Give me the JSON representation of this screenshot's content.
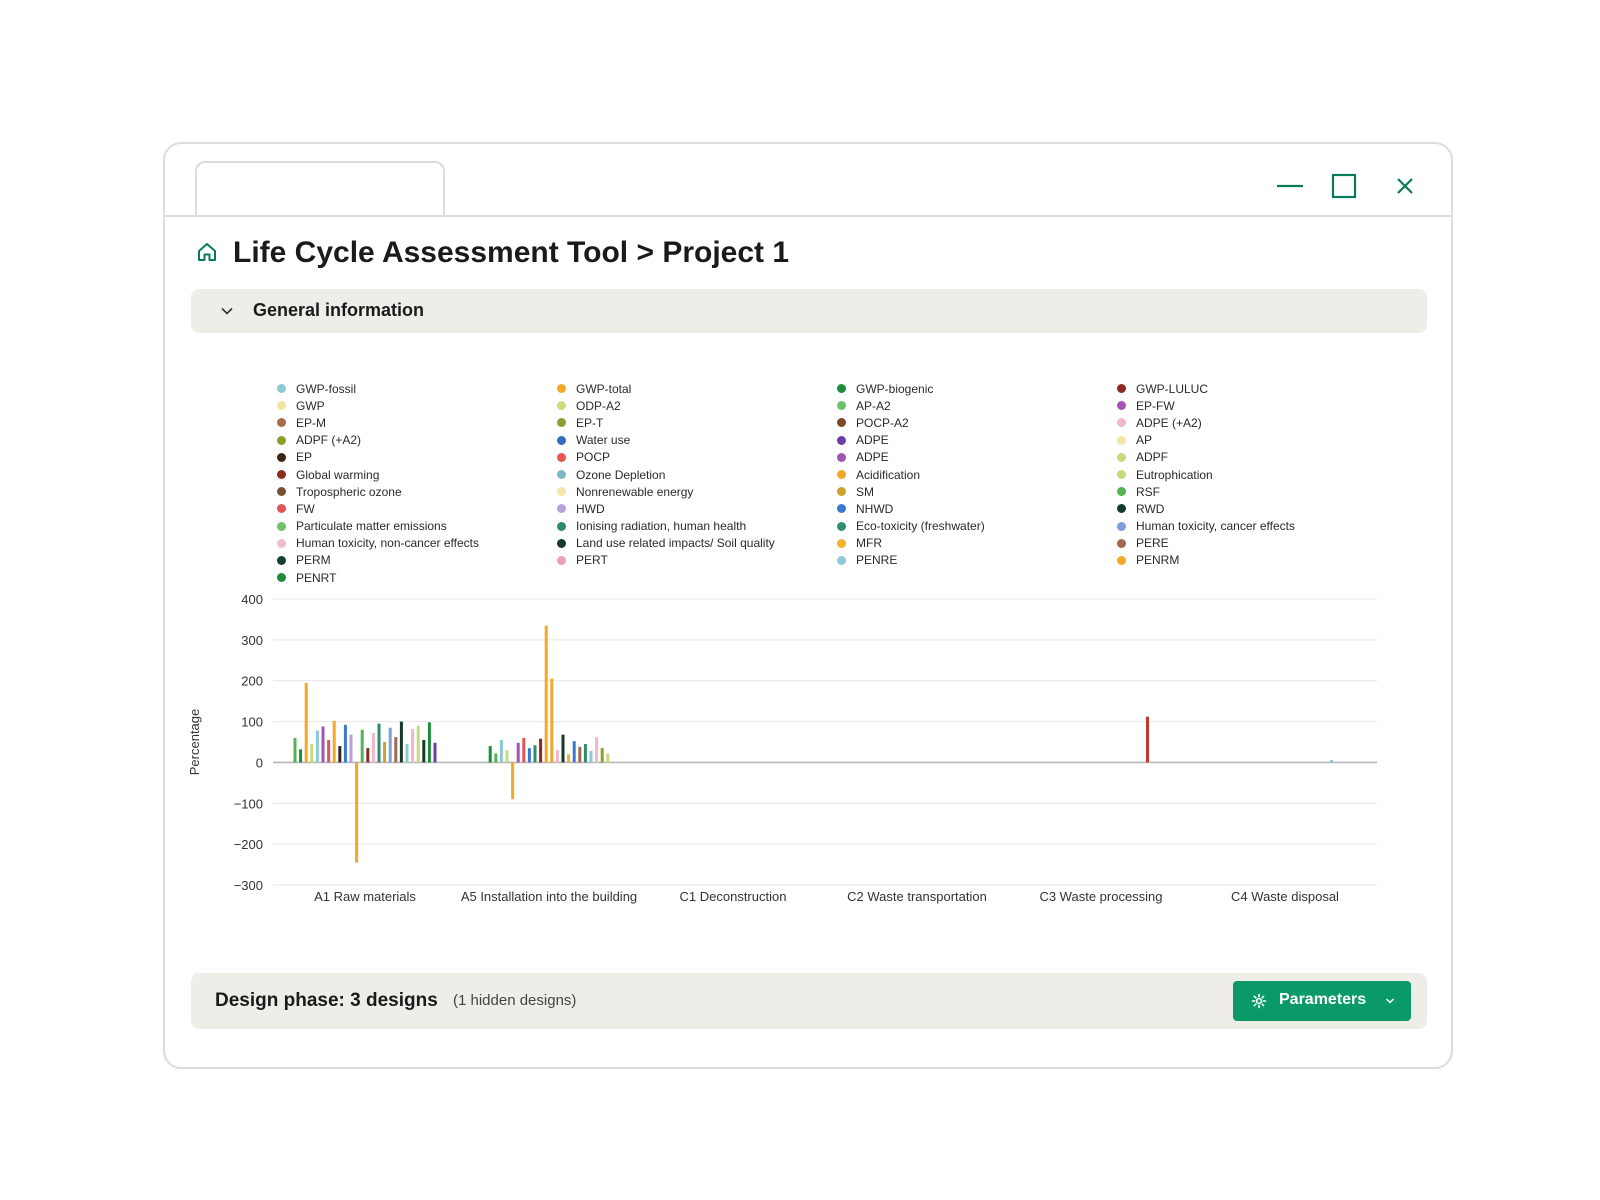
{
  "window": {
    "title": "Life Cycle Assessment Tool > Project 1",
    "tab_label": ""
  },
  "icons": {
    "home": "home-icon",
    "minimize": "minimize-icon",
    "maximize": "maximize-icon",
    "close": "close-icon",
    "chevron": "chevron-down-icon",
    "gear": "gear-icon"
  },
  "accordion": {
    "label": "General information",
    "expanded": false
  },
  "footer": {
    "phase_label": "Design phase: 3 designs",
    "hidden_label": "(1 hidden designs)",
    "parameters_label": "Parameters"
  },
  "colors": {
    "accent": "#0a9a6a",
    "panel_bg": "#efede7"
  },
  "legend": [
    [
      {
        "label": "GWP-fossil",
        "color": "#8ecad6"
      },
      {
        "label": "GWP",
        "color": "#f1e3a1"
      },
      {
        "label": "EP-M",
        "color": "#a9694c"
      },
      {
        "label": "ADPF (+A2)",
        "color": "#8f9d2f"
      },
      {
        "label": "EP",
        "color": "#3a2616"
      },
      {
        "label": "Global warming",
        "color": "#8a2f1e"
      },
      {
        "label": "Tropospheric ozone",
        "color": "#7a4e35"
      },
      {
        "label": "FW",
        "color": "#e25555"
      },
      {
        "label": "Particulate matter emissions",
        "color": "#6ec26a"
      },
      {
        "label": "Human toxicity, non-cancer effects",
        "color": "#f2bccb"
      },
      {
        "label": "PERM",
        "color": "#163f2a"
      },
      {
        "label": "PENRT",
        "color": "#1f8c3b"
      }
    ],
    [
      {
        "label": "GWP-total",
        "color": "#f3a827"
      },
      {
        "label": "ODP-A2",
        "color": "#c9dd7c"
      },
      {
        "label": "EP-T",
        "color": "#8b9e37"
      },
      {
        "label": "Water use",
        "color": "#2f6cc2"
      },
      {
        "label": "POCP",
        "color": "#e6554e"
      },
      {
        "label": "Ozone Depletion",
        "color": "#79b8c7"
      },
      {
        "label": "Nonrenewable energy",
        "color": "#f2e6ae"
      },
      {
        "label": "HWD",
        "color": "#b6a1dd"
      },
      {
        "label": "Ionising radiation, human health",
        "color": "#2e8b6b"
      },
      {
        "label": "Land use related impacts/ Soil quality",
        "color": "#143a2a"
      },
      {
        "label": "PERT",
        "color": "#ee9fb6"
      }
    ],
    [
      {
        "label": "GWP-biogenic",
        "color": "#1d8a3c"
      },
      {
        "label": "AP-A2",
        "color": "#6bc268"
      },
      {
        "label": "POCP-A2",
        "color": "#7a4a2b"
      },
      {
        "label": "ADPE",
        "color": "#6a3fa6"
      },
      {
        "label": "ADPE",
        "color": "#a454b5"
      },
      {
        "label": "Acidification",
        "color": "#f2a72a"
      },
      {
        "label": "SM",
        "color": "#c9a32c"
      },
      {
        "label": "NHWD",
        "color": "#3b79d0"
      },
      {
        "label": "Eco-toxicity (freshwater)",
        "color": "#2e8d6b"
      },
      {
        "label": "MFR",
        "color": "#f3b32b"
      },
      {
        "label": "PENRE",
        "color": "#8fcad6"
      }
    ],
    [
      {
        "label": "GWP-LULUC",
        "color": "#8b2a1e"
      },
      {
        "label": "EP-FW",
        "color": "#a454b5"
      },
      {
        "label": "ADPE (+A2)",
        "color": "#f2b7c8"
      },
      {
        "label": "AP",
        "color": "#f3e6a4"
      },
      {
        "label": "ADPF",
        "color": "#c6dc7c"
      },
      {
        "label": "Eutrophication",
        "color": "#c3da7a"
      },
      {
        "label": "RSF",
        "color": "#52b356"
      },
      {
        "label": "RWD",
        "color": "#163a2a"
      },
      {
        "label": "Human toxicity, cancer effects",
        "color": "#7b9fd6"
      },
      {
        "label": "PERE",
        "color": "#9c6a4c"
      },
      {
        "label": "PENRM",
        "color": "#f3a827"
      }
    ]
  ],
  "chart_data": {
    "type": "bar",
    "ylabel": "Percentage",
    "ylim": [
      -300,
      400
    ],
    "yticks": [
      400,
      300,
      200,
      100,
      0,
      -100,
      -200,
      -300
    ],
    "yticklabels": [
      "400",
      "300",
      "200",
      "100",
      "0",
      "−100",
      "−200",
      "−300"
    ],
    "grid": true,
    "legend_position": "top",
    "categories": [
      "A1 Raw materials",
      "A5 Installation into the building",
      "C1 Deconstruction",
      "C2 Waste transportation",
      "C3 Waste processing",
      "C4 Waste disposal"
    ],
    "groups": [
      {
        "category": "A1 Raw materials",
        "bars": [
          {
            "value": 60,
            "color": "#52b356"
          },
          {
            "value": 32,
            "color": "#1d8a3c"
          },
          {
            "value": 195,
            "color": "#f3a827"
          },
          {
            "value": 45,
            "color": "#c6dc7c"
          },
          {
            "value": 78,
            "color": "#8ecad6"
          },
          {
            "value": 88,
            "color": "#a454b5"
          },
          {
            "value": 55,
            "color": "#e25555"
          },
          {
            "value": 102,
            "color": "#f3a827"
          },
          {
            "value": 40,
            "color": "#3a2616"
          },
          {
            "value": 92,
            "color": "#3b79d0"
          },
          {
            "value": 68,
            "color": "#b6a1dd"
          },
          {
            "value": -245,
            "color": "#f3a827"
          },
          {
            "value": 80,
            "color": "#52b356"
          },
          {
            "value": 35,
            "color": "#8b2a1e"
          },
          {
            "value": 72,
            "color": "#f2b7c8"
          },
          {
            "value": 95,
            "color": "#2e8b6b"
          },
          {
            "value": 50,
            "color": "#c9a32c"
          },
          {
            "value": 85,
            "color": "#7b9fd6"
          },
          {
            "value": 62,
            "color": "#9c6a4c"
          },
          {
            "value": 100,
            "color": "#163a2a"
          },
          {
            "value": 45,
            "color": "#8ecad6"
          },
          {
            "value": 82,
            "color": "#f2b7c8"
          },
          {
            "value": 90,
            "color": "#c6dc7c"
          },
          {
            "value": 55,
            "color": "#143a2a"
          },
          {
            "value": 98,
            "color": "#1d8a3c"
          },
          {
            "value": 48,
            "color": "#6a3fa6"
          }
        ]
      },
      {
        "category": "A5 Installation into the building",
        "bars": [
          {
            "value": 40,
            "color": "#1d8a3c"
          },
          {
            "value": 22,
            "color": "#52b356"
          },
          {
            "value": 55,
            "color": "#8ecad6"
          },
          {
            "value": 30,
            "color": "#c6dc7c"
          },
          {
            "value": -90,
            "color": "#f3a827"
          },
          {
            "value": 48,
            "color": "#a454b5"
          },
          {
            "value": 60,
            "color": "#e25555"
          },
          {
            "value": 35,
            "color": "#3b79d0"
          },
          {
            "value": 42,
            "color": "#2e8d6b"
          },
          {
            "value": 58,
            "color": "#8b2a1e"
          },
          {
            "value": 335,
            "color": "#f3a827"
          },
          {
            "value": 205,
            "color": "#f3a827"
          },
          {
            "value": 30,
            "color": "#f2b7c8"
          },
          {
            "value": 68,
            "color": "#163a2a"
          },
          {
            "value": 20,
            "color": "#f3b32b"
          },
          {
            "value": 52,
            "color": "#3b79d0"
          },
          {
            "value": 38,
            "color": "#9c6a4c"
          },
          {
            "value": 45,
            "color": "#2e8b6b"
          },
          {
            "value": 28,
            "color": "#8ecad6"
          },
          {
            "value": 62,
            "color": "#f2b7c8"
          },
          {
            "value": 35,
            "color": "#8f9d2f"
          },
          {
            "value": 22,
            "color": "#c6dc7c"
          }
        ]
      },
      {
        "category": "C1 Deconstruction",
        "bars": []
      },
      {
        "category": "C2 Waste transportation",
        "bars": []
      },
      {
        "category": "C3 Waste processing",
        "bars": [
          {
            "value": 112,
            "color": "#c0392b"
          }
        ]
      },
      {
        "category": "C4 Waste disposal",
        "bars": [
          {
            "value": 6,
            "color": "#8ecad6"
          }
        ]
      }
    ]
  }
}
